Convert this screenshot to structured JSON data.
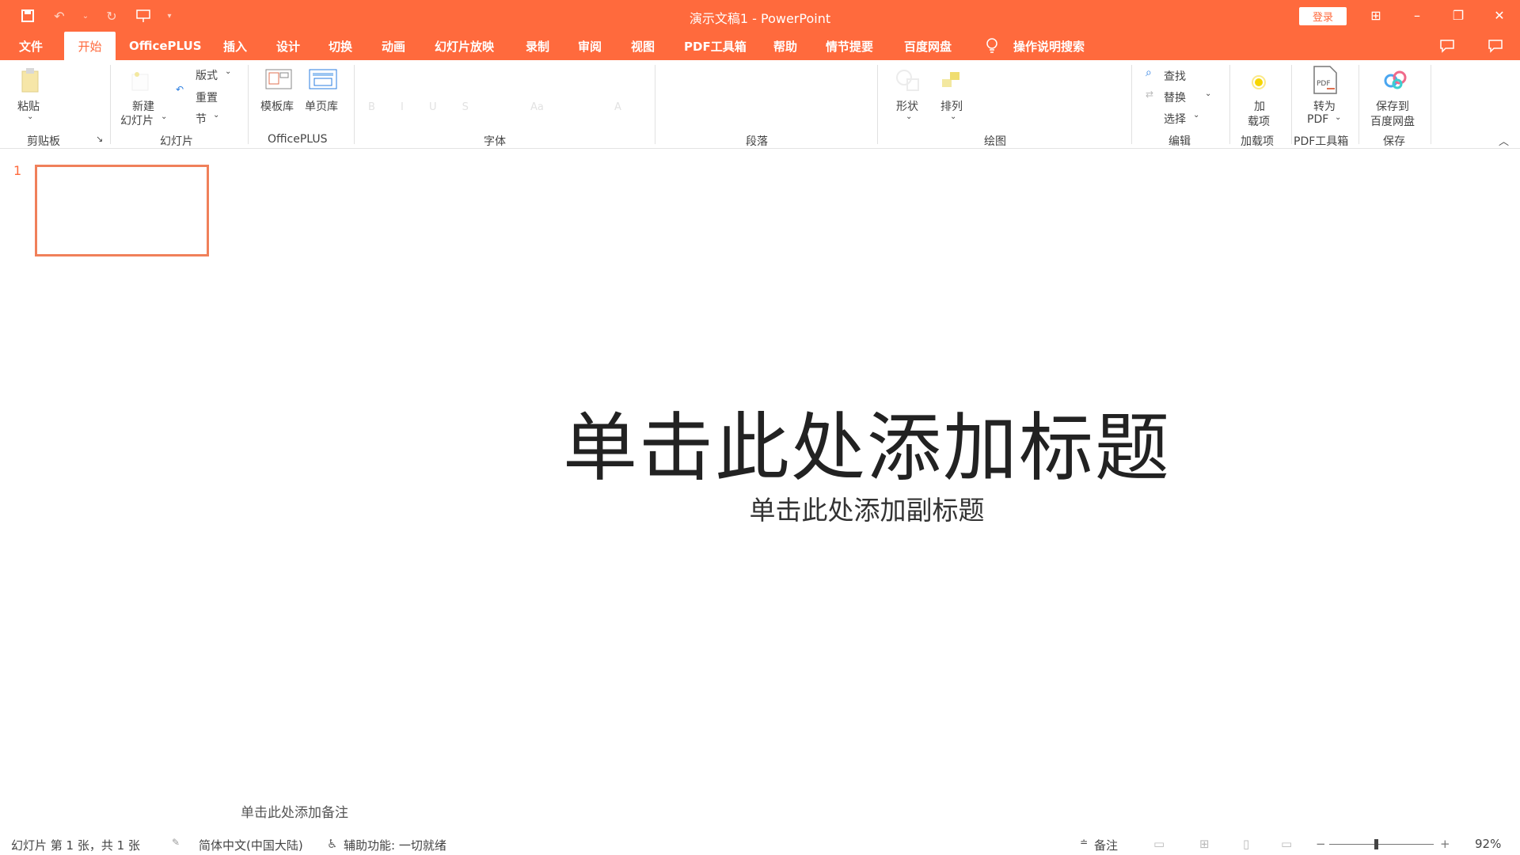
{
  "window": {
    "title": "演示文稿1  -  PowerPoint",
    "login_label": "登录"
  },
  "tabs": [
    {
      "label": "文件"
    },
    {
      "label": "开始",
      "active": true
    },
    {
      "label": "OfficePLUS"
    },
    {
      "label": "插入"
    },
    {
      "label": "设计"
    },
    {
      "label": "切换"
    },
    {
      "label": "动画"
    },
    {
      "label": "幻灯片放映"
    },
    {
      "label": "录制"
    },
    {
      "label": "审阅"
    },
    {
      "label": "视图"
    },
    {
      "label": "PDF工具箱"
    },
    {
      "label": "帮助"
    },
    {
      "label": "情节提要"
    },
    {
      "label": "百度网盘"
    },
    {
      "label": "操作说明搜索"
    }
  ],
  "ribbon": {
    "clipboard": {
      "paste": "粘贴",
      "group": "剪贴板"
    },
    "slides": {
      "new_slide_1": "新建",
      "new_slide_2": "幻灯片",
      "layout": "版式",
      "reset": "重置",
      "section": "节",
      "group": "幻灯片"
    },
    "officeplus": {
      "template_lib": "模板库",
      "single_page_lib": "单页库",
      "group": "OfficePLUS"
    },
    "font": {
      "group": "字体"
    },
    "paragraph": {
      "group": "段落"
    },
    "drawing": {
      "shapes": "形状",
      "arrange": "排列",
      "group": "绘图"
    },
    "editing": {
      "find": "查找",
      "replace": "替换",
      "select": "选择",
      "group": "编辑"
    },
    "addins": {
      "line1": "加",
      "line2": "载项",
      "group": "加载项"
    },
    "pdf": {
      "line1": "转为",
      "line2": "PDF",
      "group": "PDF工具箱"
    },
    "save": {
      "line1": "保存到",
      "line2": "百度网盘",
      "group": "保存"
    }
  },
  "slides_panel": {
    "number": "1"
  },
  "slide": {
    "title_placeholder": "单击此处添加标题",
    "subtitle_placeholder": "单击此处添加副标题"
  },
  "notes_placeholder": "单击此处添加备注",
  "status": {
    "slide_info": "幻灯片 第 1 张，共 1 张",
    "language": "简体中文(中国大陆)",
    "accessibility": "辅助功能: 一切就绪",
    "notes": "备注",
    "zoom": "92%"
  },
  "colors": {
    "accent": "#ff6a3d",
    "thumb_border": "#f0805a"
  }
}
